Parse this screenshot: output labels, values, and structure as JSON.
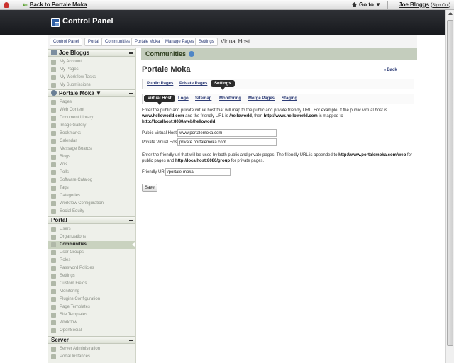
{
  "dockbar": {
    "back_label": "Back to Portale Moka",
    "goto_label": "Go to ▼",
    "user_name": "Joe Bloggs",
    "sign_out_label": "Sign Out"
  },
  "header": {
    "title": "Control Panel"
  },
  "breadcrumb": [
    "Control Panel",
    "Portal",
    "Communities",
    "Portale Moka",
    "Manage Pages",
    "Settings",
    "Virtual Host"
  ],
  "sidebar": {
    "user_section": {
      "title": "Joe Bloggs",
      "items": [
        "My Account",
        "My Pages",
        "My Workflow Tasks",
        "My Submissions"
      ]
    },
    "site_section": {
      "title": "Portale Moka ▼",
      "items": [
        "Pages",
        "Web Content",
        "Document Library",
        "Image Gallery",
        "Bookmarks",
        "Calendar",
        "Message Boards",
        "Blogs",
        "Wiki",
        "Polls",
        "Software Catalog",
        "Tags",
        "Categories",
        "Workflow Configuration",
        "Social Equity"
      ]
    },
    "portal_section": {
      "title": "Portal",
      "items": [
        "Users",
        "Organizations",
        "Communities",
        "User Groups",
        "Roles",
        "Password Policies",
        "Settings",
        "Custom Fields",
        "Monitoring",
        "Plugins Configuration",
        "Page Templates",
        "Site Templates",
        "Workflow",
        "OpenSocial"
      ],
      "selected": "Communities"
    },
    "server_section": {
      "title": "Server",
      "items": [
        "Server Administration",
        "Portal Instances"
      ]
    }
  },
  "main": {
    "portlet_title": "Communities",
    "site_name": "Portale Moka",
    "back_label": "Back",
    "page_tabs": [
      "Public Pages",
      "Private Pages",
      "Settings"
    ],
    "page_tabs_selected": "Settings",
    "setting_tabs": [
      "Virtual Host",
      "Logo",
      "Sitemap",
      "Monitoring",
      "Merge Pages",
      "Staging"
    ],
    "setting_tabs_selected": "Virtual Host",
    "vh_intro": {
      "text1": "Enter the public and private virtual host that will map to the public and private friendly URL. For example, if the public virtual host is ",
      "b1": "www.helloworld.com",
      "text2": " and the friendly URL is ",
      "b2": "/helloworld",
      "text3": ", then ",
      "b3": "http://www.helloworld.com",
      "text4": " is mapped to ",
      "b4": "http://localhost:8080/web/helloworld",
      "text5": "."
    },
    "public_vh_label": "Public Virtual Host",
    "public_vh_value": "www.portalemoka.com",
    "private_vh_label": "Private Virtual Host",
    "private_vh_value": "private.portalemoka.com",
    "friendly_intro": {
      "text1": "Enter the friendly url that will be used by both public and private pages. The friendly URL is appended to ",
      "b1": "http://www.portalemoka.com/web",
      "text2": " for public pages and ",
      "b2": "http://localhost:8080/group",
      "text3": " for private pages."
    },
    "friendly_url_label": "Friendly URL",
    "friendly_url_value": "/portale-moka",
    "save_label": "Save"
  }
}
